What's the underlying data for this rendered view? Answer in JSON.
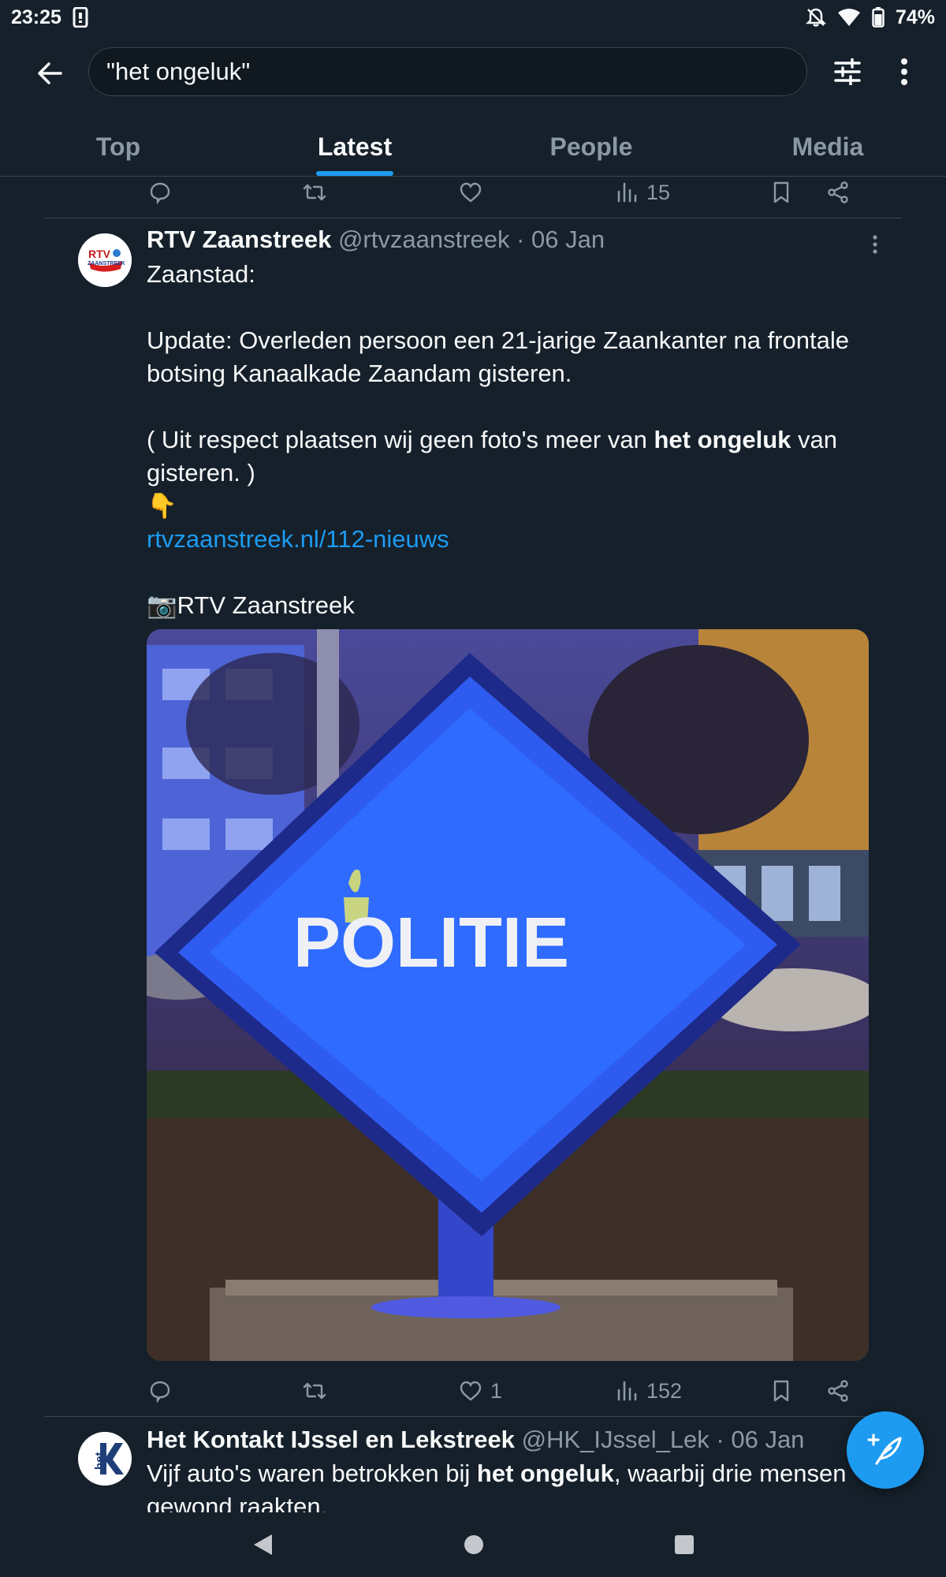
{
  "status_bar": {
    "time": "23:25",
    "battery": "74%",
    "icons": [
      "screenshot-icon",
      "bell-off-icon",
      "wifi-icon",
      "battery-icon"
    ]
  },
  "search": {
    "query": "\"het ongeluk\""
  },
  "tabs": [
    {
      "label": "Top",
      "active": false
    },
    {
      "label": "Latest",
      "active": true
    },
    {
      "label": "People",
      "active": false
    },
    {
      "label": "Media",
      "active": false
    }
  ],
  "prev_tweet": {
    "views": "15"
  },
  "tweet1": {
    "name": "RTV Zaanstreek",
    "handle_date": "@rtvzaanstreek · 06 Jan",
    "avatar_text": "RTV ZAANSTREEK",
    "line1": "Zaanstad:",
    "line2": "Update: Overleden persoon een 21-jarige Zaankanter na frontale botsing Kanaalkade Zaandam gisteren.",
    "line3_pre": "( Uit respect plaatsen wij geen foto's meer van ",
    "line3_bold": "het ongeluk",
    "line3_post": " van gisteren. )",
    "emoji": "👇",
    "link": "rtvzaanstreek.nl/112-nieuws",
    "credit": "📷RTV Zaanstreek",
    "image_sign_text": "POLITIE",
    "likes": "1",
    "views": "152"
  },
  "tweet2": {
    "name": "Het Kontakt IJssel en Lekstreek",
    "handle_date": "@HK_IJssel_Lek · 06 Jan",
    "avatar_text": "het K",
    "text_pre": "Vijf auto's waren betrokken bij ",
    "text_bold": "het ongeluk",
    "text_post": ", waarbij drie mensen gewond raakten."
  },
  "colors": {
    "background": "#15202b",
    "accent": "#1d9bf0",
    "muted": "#8b98a5",
    "divider": "#38444d"
  }
}
